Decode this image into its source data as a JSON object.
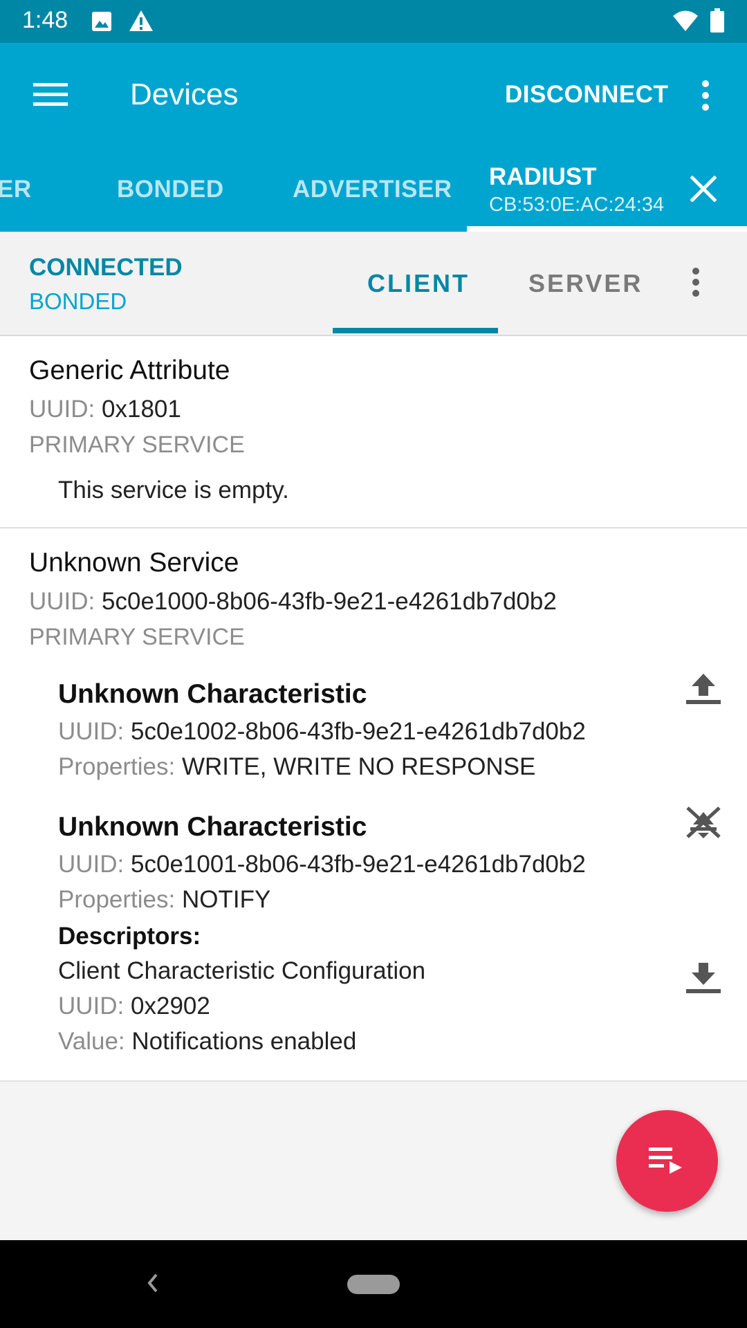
{
  "status_bar": {
    "time": "1:48"
  },
  "app_bar": {
    "title": "Devices",
    "disconnect_label": "DISCONNECT",
    "tabs": [
      {
        "label": "ER"
      },
      {
        "label": "BONDED"
      },
      {
        "label": "ADVERTISER"
      }
    ],
    "active_device": {
      "name": "RADIUST",
      "address": "CB:53:0E:AC:24:34"
    }
  },
  "connection": {
    "state": "CONNECTED",
    "bond_state": "BONDED",
    "tabs": [
      {
        "label": "CLIENT",
        "active": true
      },
      {
        "label": "SERVER",
        "active": false
      }
    ]
  },
  "labels": {
    "uuid": "UUID:",
    "properties": "Properties:",
    "descriptors": "Descriptors:",
    "value": "Value:"
  },
  "services": [
    {
      "name": "Generic Attribute",
      "uuid": "0x1801",
      "type": "PRIMARY SERVICE",
      "empty_text": "This service is empty."
    },
    {
      "name": "Unknown Service",
      "uuid": "5c0e1000-8b06-43fb-9e21-e4261db7d0b2",
      "type": "PRIMARY SERVICE",
      "characteristics": [
        {
          "name": "Unknown Characteristic",
          "uuid": "5c0e1002-8b06-43fb-9e21-e4261db7d0b2",
          "properties": "WRITE, WRITE NO RESPONSE",
          "action_icon": "upload-icon"
        },
        {
          "name": "Unknown Characteristic",
          "uuid": "5c0e1001-8b06-43fb-9e21-e4261db7d0b2",
          "properties": "NOTIFY",
          "action_icon": "notifications-disable-icon",
          "descriptor": {
            "name": "Client Characteristic Configuration",
            "uuid": "0x2902",
            "value": "Notifications enabled",
            "action_icon": "download-icon"
          }
        }
      ]
    }
  ],
  "colors": {
    "status_bar": "#0087a5",
    "app_bar": "#00a5cf",
    "accent": "#0087a5",
    "fab": "#ea2e51"
  }
}
